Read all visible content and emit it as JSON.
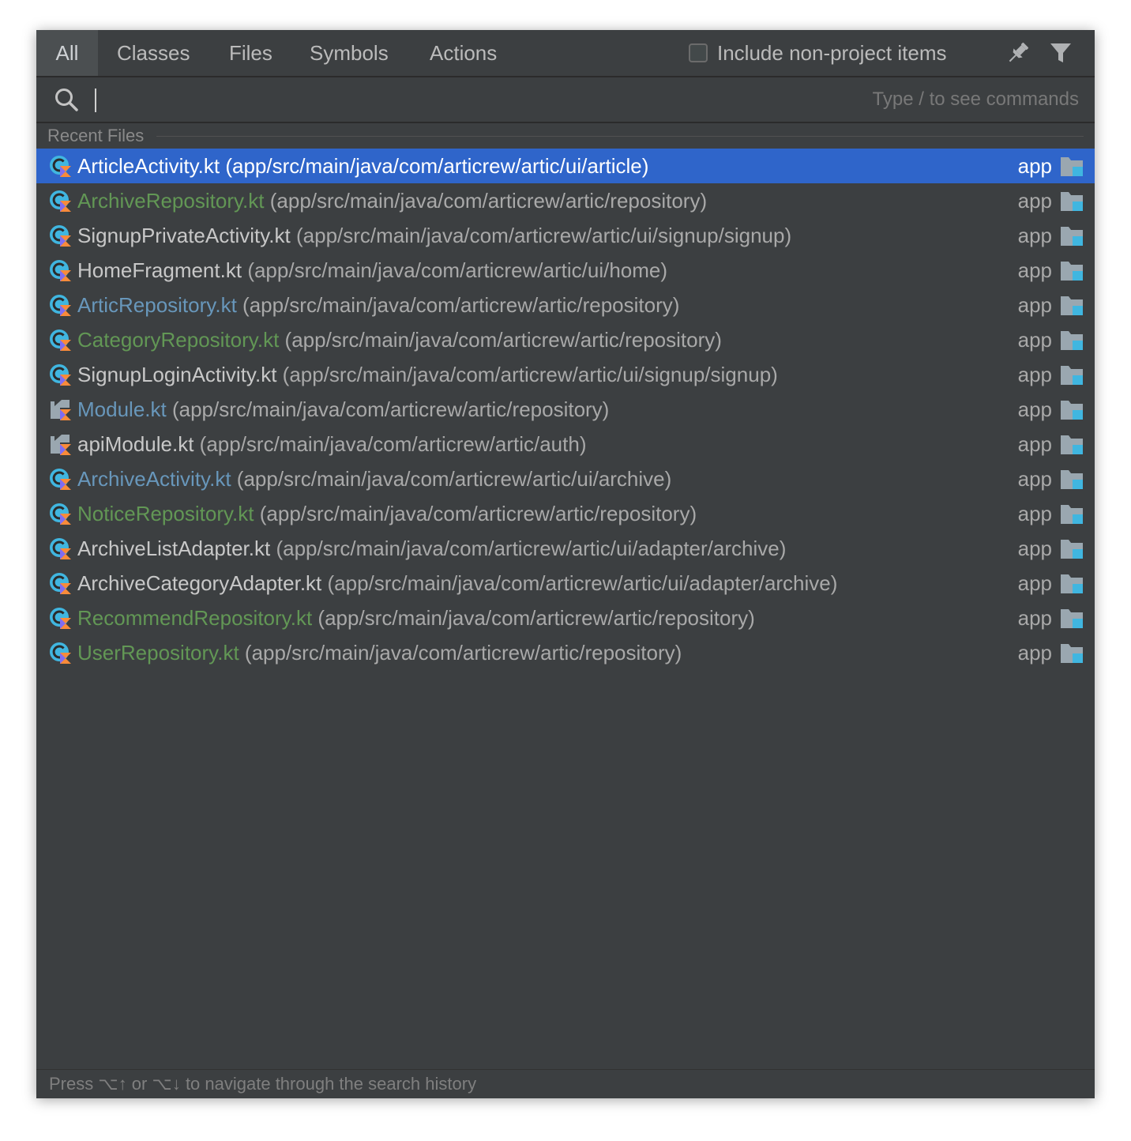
{
  "tabs": [
    {
      "label": "All",
      "active": true
    },
    {
      "label": "Classes"
    },
    {
      "label": "Files"
    },
    {
      "label": "Symbols"
    },
    {
      "label": "Actions"
    }
  ],
  "include_non_project": {
    "label": "Include non-project items",
    "checked": false
  },
  "toolbar": {
    "pin_icon": "pin-icon",
    "filter_icon": "filter-icon"
  },
  "search": {
    "value": "",
    "hint": "Type / to see commands"
  },
  "section_title": "Recent Files",
  "colors": {
    "selected_bg": "#2f65ca",
    "default_name": "#c8c8c8",
    "modified_blue": "#6897bb",
    "added_green": "#629755",
    "path_gray": "#a9a9a9"
  },
  "files": [
    {
      "name": "ArticleActivity.kt",
      "path": "(app/src/main/java/com/articrew/artic/ui/article)",
      "module": "app",
      "color": "#ffffff",
      "icon": "kotlin-class-icon",
      "selected": true
    },
    {
      "name": "ArchiveRepository.kt",
      "path": "(app/src/main/java/com/articrew/artic/repository)",
      "module": "app",
      "color": "#629755",
      "icon": "kotlin-class-icon"
    },
    {
      "name": "SignupPrivateActivity.kt",
      "path": "(app/src/main/java/com/articrew/artic/ui/signup/signup)",
      "module": "app",
      "color": "#c8c8c8",
      "icon": "kotlin-class-icon"
    },
    {
      "name": "HomeFragment.kt",
      "path": "(app/src/main/java/com/articrew/artic/ui/home)",
      "module": "app",
      "color": "#c8c8c8",
      "icon": "kotlin-class-icon"
    },
    {
      "name": "ArticRepository.kt",
      "path": "(app/src/main/java/com/articrew/artic/repository)",
      "module": "app",
      "color": "#6897bb",
      "icon": "kotlin-class-icon"
    },
    {
      "name": "CategoryRepository.kt",
      "path": "(app/src/main/java/com/articrew/artic/repository)",
      "module": "app",
      "color": "#629755",
      "icon": "kotlin-class-icon"
    },
    {
      "name": "SignupLoginActivity.kt",
      "path": "(app/src/main/java/com/articrew/artic/ui/signup/signup)",
      "module": "app",
      "color": "#c8c8c8",
      "icon": "kotlin-class-icon"
    },
    {
      "name": "Module.kt",
      "path": "(app/src/main/java/com/articrew/artic/repository)",
      "module": "app",
      "color": "#6897bb",
      "icon": "kotlin-file-icon"
    },
    {
      "name": "apiModule.kt",
      "path": "(app/src/main/java/com/articrew/artic/auth)",
      "module": "app",
      "color": "#c8c8c8",
      "icon": "kotlin-file-icon"
    },
    {
      "name": "ArchiveActivity.kt",
      "path": "(app/src/main/java/com/articrew/artic/ui/archive)",
      "module": "app",
      "color": "#6897bb",
      "icon": "kotlin-class-icon"
    },
    {
      "name": "NoticeRepository.kt",
      "path": "(app/src/main/java/com/articrew/artic/repository)",
      "module": "app",
      "color": "#629755",
      "icon": "kotlin-class-icon"
    },
    {
      "name": "ArchiveListAdapter.kt",
      "path": "(app/src/main/java/com/articrew/artic/ui/adapter/archive)",
      "module": "app",
      "color": "#c8c8c8",
      "icon": "kotlin-class-icon"
    },
    {
      "name": "ArchiveCategoryAdapter.kt",
      "path": "(app/src/main/java/com/articrew/artic/ui/adapter/archive)",
      "module": "app",
      "color": "#c8c8c8",
      "icon": "kotlin-class-icon"
    },
    {
      "name": "RecommendRepository.kt",
      "path": "(app/src/main/java/com/articrew/artic/repository)",
      "module": "app",
      "color": "#629755",
      "icon": "kotlin-class-icon"
    },
    {
      "name": "UserRepository.kt",
      "path": "(app/src/main/java/com/articrew/artic/repository)",
      "module": "app",
      "color": "#629755",
      "icon": "kotlin-class-icon"
    }
  ],
  "footer": "Press ⌥↑ or ⌥↓ to navigate through the search history"
}
